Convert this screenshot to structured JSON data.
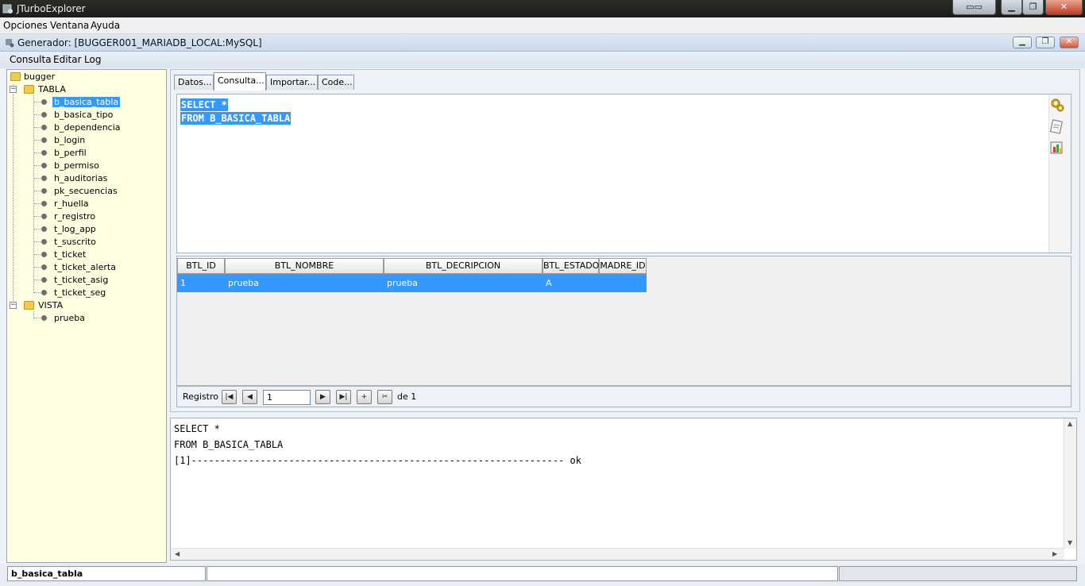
{
  "window": {
    "title": "JTurboExplorer",
    "icon": "app-icon",
    "controls": [
      "minimize",
      "maximize",
      "close"
    ]
  },
  "menu": [
    "Opciones",
    "Ventana",
    "Ayuda"
  ],
  "inner_frame": {
    "title": "Generador: [BUGGER001_MARIADB_LOCAL:MySQL]",
    "menu": [
      "Consulta",
      "Editar",
      "Log"
    ]
  },
  "tree": {
    "root": "bugger",
    "tabla_label": "TABLA",
    "tables": [
      "b_basica_tabla",
      "b_basica_tipo",
      "b_dependencia",
      "b_login",
      "b_perfil",
      "b_permiso",
      "h_auditorias",
      "pk_secuencias",
      "r_huella",
      "r_registro",
      "t_log_app",
      "t_suscrito",
      "t_ticket",
      "t_ticket_alerta",
      "t_ticket_asig",
      "t_ticket_seg"
    ],
    "vista_label": "VISTA",
    "views": [
      "prueba"
    ],
    "selected": "b_basica_tabla"
  },
  "tabs": [
    "Datos...",
    "Consulta...",
    "Importar...",
    "Code..."
  ],
  "active_tab": "Consulta...",
  "query": {
    "line1": "SELECT *",
    "line2": "FROM B_BASICA_TABLA"
  },
  "editor_icons": [
    "gear-icon",
    "edit-icon",
    "chart-icon"
  ],
  "result": {
    "columns": [
      "BTL_ID",
      "BTL_NOMBRE",
      "BTL_DECRIPCION",
      "BTL_ESTADO",
      "MADRE_ID"
    ],
    "rows": [
      [
        "1",
        "prueba",
        "prueba",
        "A",
        ""
      ]
    ]
  },
  "navigator": {
    "label": "Registro",
    "current": "1",
    "total_label": "de 1"
  },
  "log": {
    "line1": "SELECT *",
    "line2": "FROM B_BASICA_TABLA",
    "line3": "[1]----------------------------------------------------------------- ok"
  },
  "status": {
    "selected_object": "b_basica_tabla",
    "message": ""
  },
  "colors": {
    "selection": "#3399ff",
    "tree_background": "#ffffe1"
  }
}
